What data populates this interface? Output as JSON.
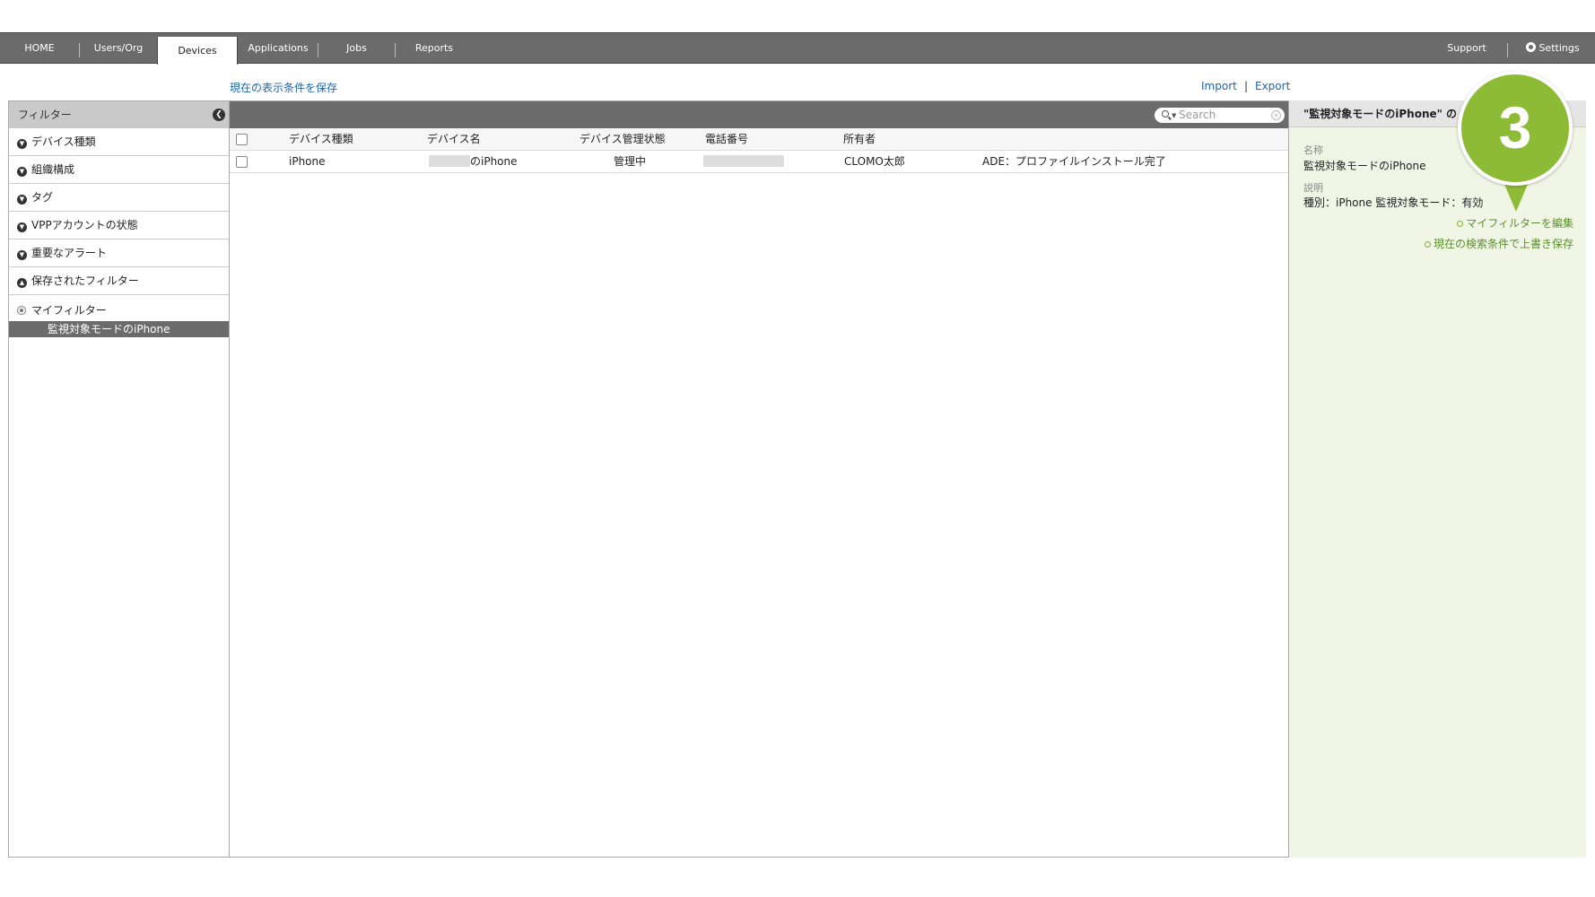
{
  "nav": {
    "home": "HOME",
    "users": "Users/Org",
    "devices": "Devices",
    "applications": "Applications",
    "jobs": "Jobs",
    "reports": "Reports",
    "support": "Support",
    "settings": "Settings"
  },
  "links": {
    "save_view": "現在の表示条件を保存",
    "import": "Import",
    "separator": "|",
    "export": "Export"
  },
  "sidebar": {
    "title": "フィルター",
    "items": [
      {
        "label": "デバイス種類"
      },
      {
        "label": "組織構成"
      },
      {
        "label": "タグ"
      },
      {
        "label": "VPPアカウントの状態"
      },
      {
        "label": "重要なアラート"
      },
      {
        "label": "保存されたフィルター"
      }
    ],
    "my_filter": {
      "label": "マイフィルター",
      "selected_item": "監視対象モードのiPhone"
    }
  },
  "search": {
    "placeholder": "Search"
  },
  "table": {
    "headers": [
      "デバイス種類",
      "デバイス名",
      "デバイス管理状態",
      "電話番号",
      "所有者"
    ],
    "rows": [
      {
        "type": "iPhone",
        "name_suffix": "のiPhone",
        "status": "管理中",
        "owner": "CLOMO太郎",
        "ade": "ADE：プロファイルインストール完了"
      }
    ]
  },
  "detail": {
    "header": "\"監視対象モードのiPhone\" の",
    "name_label": "名称",
    "name_value": "監視対象モードのiPhone",
    "desc_label": "説明",
    "desc_value": "種別：iPhone 監視対象モード：有効",
    "edit_link": "マイフィルターを編集",
    "overwrite_link": "現在の検索条件で上書き保存"
  },
  "callout": {
    "number": "3"
  },
  "colors": {
    "nav_bg": "#6b6b6b",
    "link_blue": "#1d64b0",
    "panel_bg": "#f0f5e6",
    "accent_green": "#8dbb36"
  }
}
